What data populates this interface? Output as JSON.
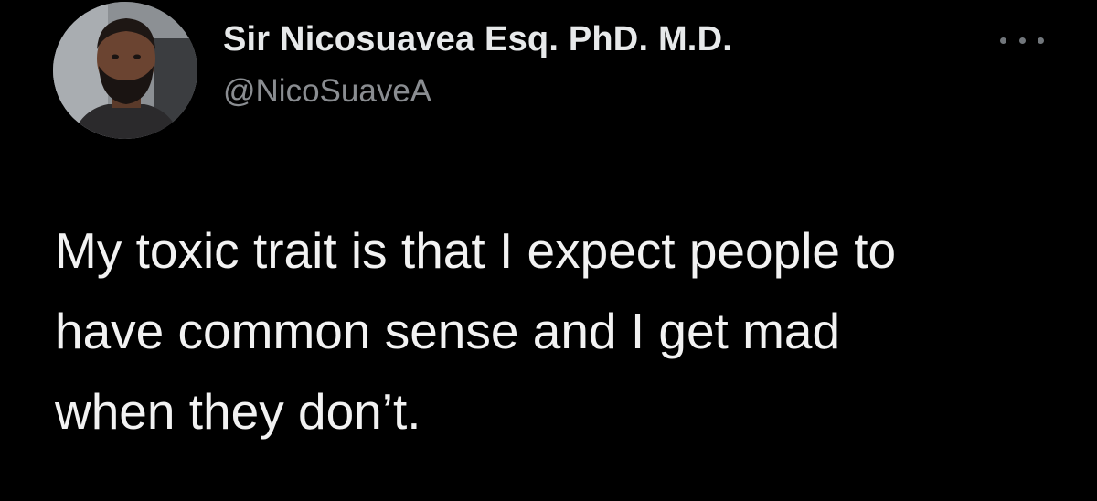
{
  "tweet": {
    "author": {
      "display_name": "Sir Nicosuavea Esq. PhD. M.D.",
      "handle": "@NicoSuaveA",
      "avatar_icon": "profile-photo"
    },
    "more_icon": "more-horizontal-icon",
    "text_lines": [
      "My toxic trait is that I expect people to",
      "have common sense and I get mad",
      "when they don’t."
    ]
  },
  "colors": {
    "background": "#000000",
    "name_text": "#e7e9ea",
    "handle_text": "#8a8d91",
    "body_text": "#f2f2f2"
  }
}
